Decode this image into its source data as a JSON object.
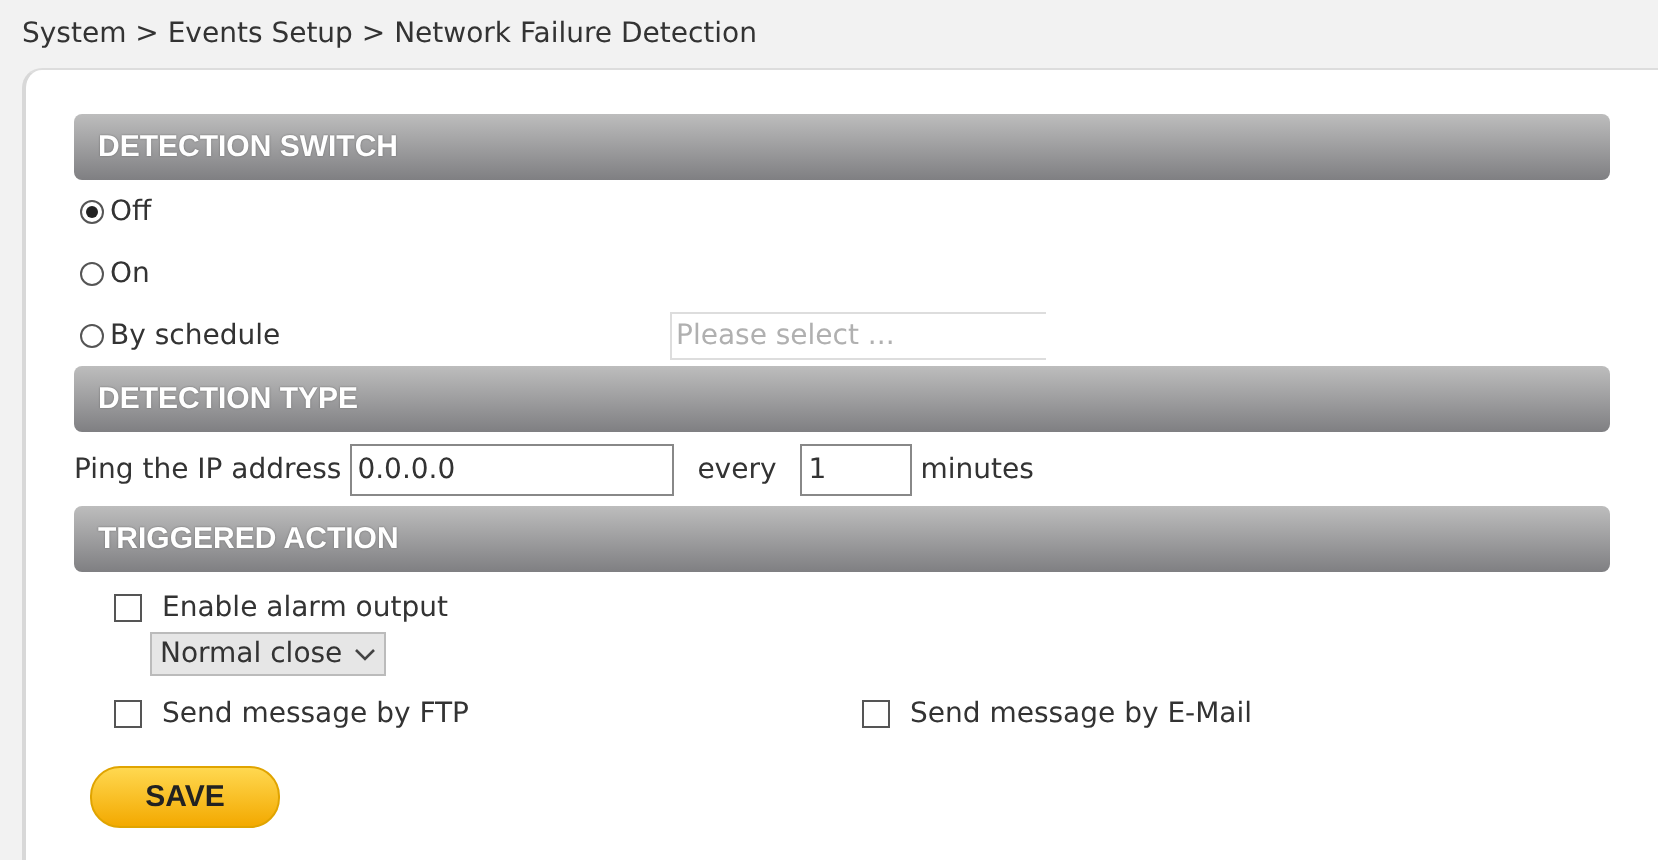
{
  "breadcrumb": "System > Events Setup > Network Failure Detection",
  "detection_switch": {
    "title": "DETECTION SWITCH",
    "options": [
      {
        "label": "Off",
        "selected": true
      },
      {
        "label": "On",
        "selected": false
      },
      {
        "label": "By schedule",
        "selected": false
      }
    ],
    "schedule_select": {
      "placeholder": "Please select ..."
    }
  },
  "detection_type": {
    "title": "DETECTION TYPE",
    "ping_label": "Ping the IP address",
    "ip_address": "0.0.0.0",
    "every_label": "every",
    "interval": "1",
    "minutes_label": "minutes"
  },
  "triggered_action": {
    "title": "TRIGGERED ACTION",
    "alarm_output": {
      "label": "Enable alarm output",
      "checked": false,
      "mode": "Normal close"
    },
    "ftp": {
      "label": "Send message by FTP",
      "checked": false
    },
    "email": {
      "label": "Send message by E-Mail",
      "checked": false
    }
  },
  "save_button": "SAVE"
}
